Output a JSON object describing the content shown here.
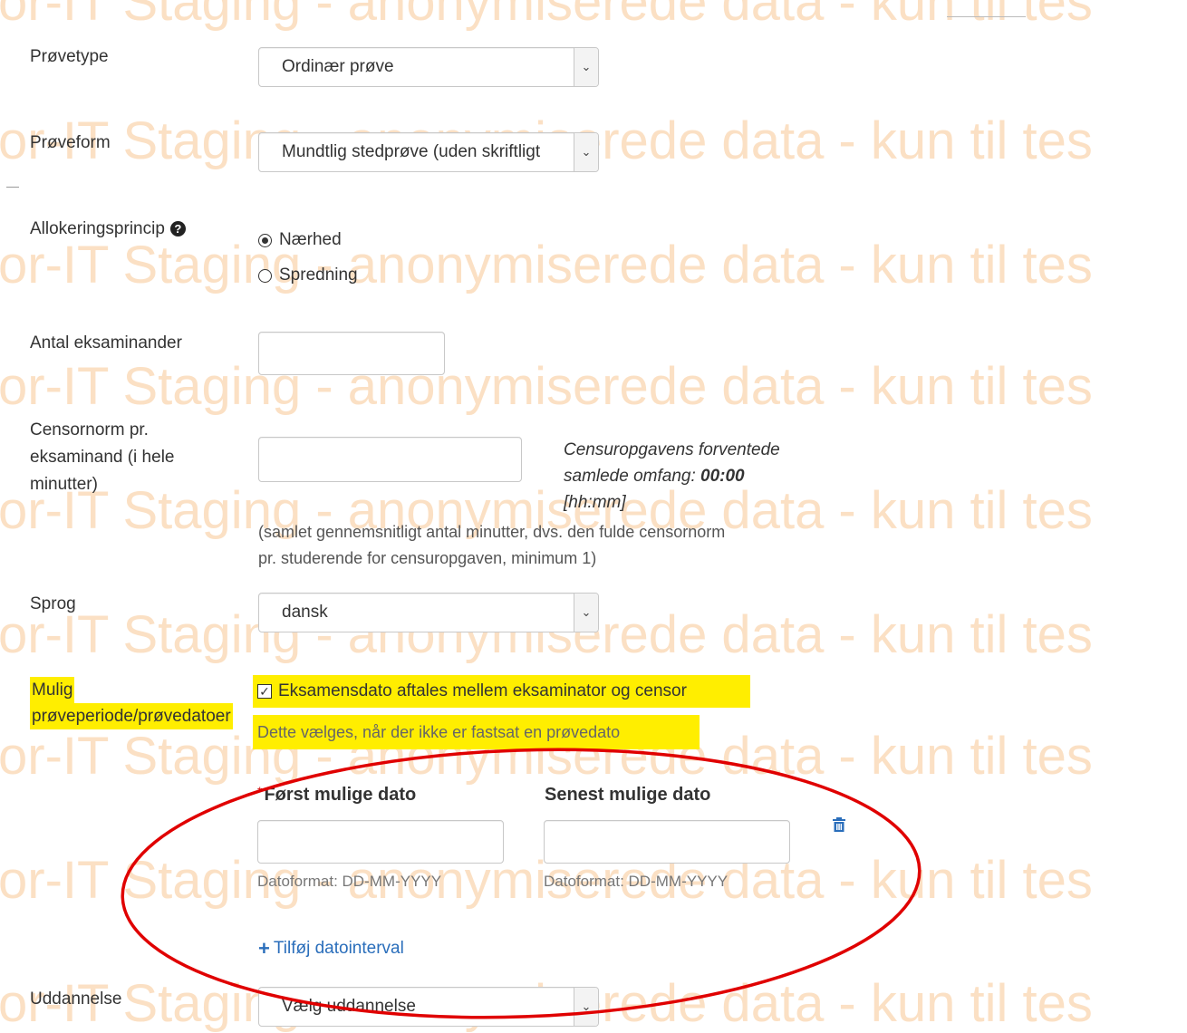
{
  "watermark": "or-IT Staging - anonymiserede data - kun til tes",
  "watermark_partial": "or-IT Staging - anonymiserede data - kun til tes",
  "fields": {
    "provetype": {
      "label": "Prøvetype",
      "value": "Ordinær prøve"
    },
    "proveform": {
      "label": "Prøveform",
      "value": "Mundtlig stedprøve (uden skriftligt"
    },
    "allokering": {
      "label": "Allokeringsprincip",
      "options": [
        "Nærhed",
        "Spredning"
      ],
      "selected": "Nærhed"
    },
    "antal": {
      "label": "Antal eksaminander",
      "value": ""
    },
    "censornorm": {
      "label_lines": [
        "Censornorm pr.",
        "eksaminand (i hele",
        "minutter)"
      ],
      "value": "",
      "info_prefix_1": "Censuropgavens forventede",
      "info_prefix_2": "samlede omfang: ",
      "info_value": "00:00",
      "info_suffix": "[hh:mm]",
      "help_1": "(samlet gennemsnitligt antal minutter, dvs. den fulde censornorm",
      "help_2": "pr. studerende for censuropgaven, minimum 1)"
    },
    "sprog": {
      "label": "Sprog",
      "value": "dansk"
    },
    "periode": {
      "label_1": "Mulig",
      "label_2": "prøveperiode/prøvedatoer",
      "checkbox_label": "Eksamensdato aftales mellem eksaminator og censor",
      "checked": true,
      "note": "Dette vælges, når der ikke er fastsat en prøvedato",
      "required_mark": "*",
      "first_label": "Først mulige dato",
      "last_label": "Senest mulige dato",
      "first_value": "",
      "last_value": "",
      "date_format": "Datoformat: DD-MM-YYYY",
      "add_interval": "Tilføj datointerval"
    },
    "uddannelse": {
      "label": "Uddannelse",
      "value": "Vælg uddannelse"
    }
  },
  "colors": {
    "watermark": "#fbe0c4",
    "highlight": "#ffee00",
    "annotation": "#e00000",
    "link": "#2a6ebb",
    "required": "#cc0000"
  }
}
